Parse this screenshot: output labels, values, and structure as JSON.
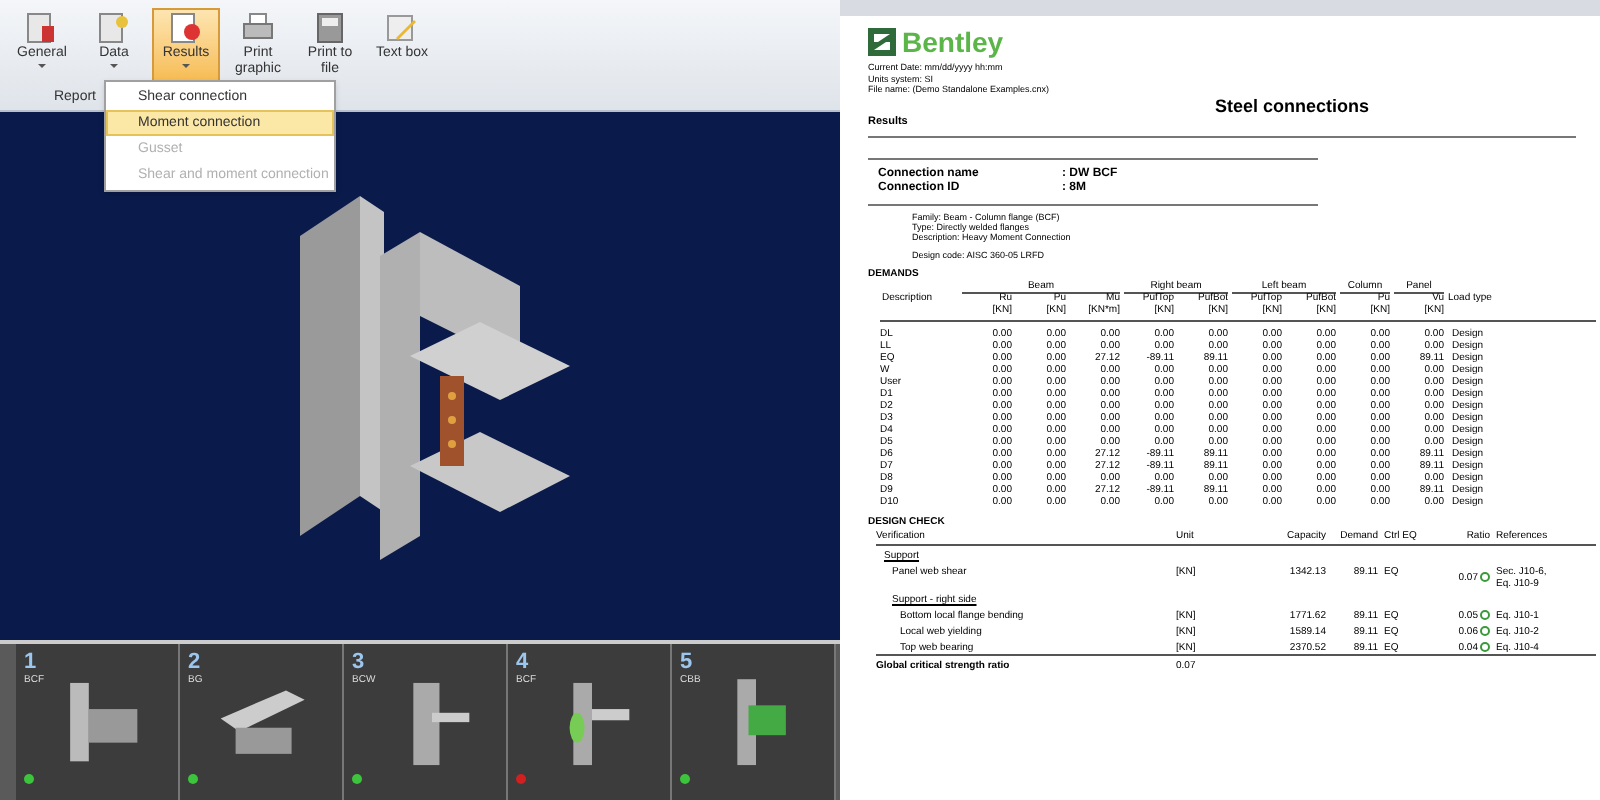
{
  "ribbon": {
    "buttons": [
      {
        "label": "General",
        "caret": true,
        "selected": false,
        "kind": "general"
      },
      {
        "label": "Data",
        "caret": true,
        "selected": false,
        "kind": "data"
      },
      {
        "label": "Results",
        "caret": true,
        "selected": true,
        "kind": "results"
      },
      {
        "label": "Print graphic",
        "caret": false,
        "selected": false,
        "kind": "printer"
      },
      {
        "label": "Print to file",
        "caret": false,
        "selected": false,
        "kind": "file"
      },
      {
        "label": "Text box",
        "caret": false,
        "selected": false,
        "kind": "text"
      }
    ],
    "group_label": "Report",
    "menu": [
      {
        "label": "Shear connection",
        "selected": false,
        "disabled": false
      },
      {
        "label": "Moment connection",
        "selected": true,
        "disabled": false
      },
      {
        "label": "Gusset",
        "selected": false,
        "disabled": true
      },
      {
        "label": "Shear and moment connection",
        "selected": false,
        "disabled": true
      }
    ]
  },
  "thumbnails": [
    {
      "number": "1",
      "code": "BCF",
      "color": "#3cc43c",
      "kind": "bcf"
    },
    {
      "number": "2",
      "code": "BG",
      "color": "#3cc43c",
      "kind": "bg"
    },
    {
      "number": "3",
      "code": "BCW",
      "color": "#3cc43c",
      "kind": "bcw"
    },
    {
      "number": "4",
      "code": "BCF",
      "color": "#d02020",
      "kind": "bcf2"
    },
    {
      "number": "5",
      "code": "CBB",
      "color": "#3cc43c",
      "kind": "cbb"
    }
  ],
  "report": {
    "logo": "Bentley",
    "meta": [
      "Current Date: mm/dd/yyyy hh:mm",
      "Units system: SI",
      "File name: (Demo Standalone Examples.cnx)"
    ],
    "title": "Steel connections",
    "section": "Results",
    "connection": [
      {
        "label": "Connection name",
        "value": ": DW BCF"
      },
      {
        "label": "Connection ID",
        "value": ": 8M"
      }
    ],
    "details": [
      "Family: Beam - Column flange (BCF)",
      "Type: Directly welded flanges",
      "Description: Heavy Moment Connection"
    ],
    "design_code": "Design code: AISC 360-05 LRFD",
    "demands": {
      "heading": "DEMANDS",
      "groups": [
        {
          "label": "Beam"
        },
        {
          "label": "Right beam"
        },
        {
          "label": "Left beam"
        },
        {
          "label": "Column"
        },
        {
          "label": "Panel"
        }
      ],
      "columns": [
        {
          "name": "Description"
        },
        {
          "name": "Ru",
          "unit": "[KN]"
        },
        {
          "name": "Pu",
          "unit": "[KN]"
        },
        {
          "name": "Mu",
          "unit": "[KN*m]"
        },
        {
          "name": "PufTop",
          "unit": "[KN]"
        },
        {
          "name": "PufBot",
          "unit": "[KN]"
        },
        {
          "name": "PufTop",
          "unit": "[KN]"
        },
        {
          "name": "PufBot",
          "unit": "[KN]"
        },
        {
          "name": "Pu",
          "unit": "[KN]"
        },
        {
          "name": "Vu",
          "unit": "[KN]"
        },
        {
          "name": "Load type"
        }
      ],
      "rows": [
        [
          "DL",
          "0.00",
          "0.00",
          "0.00",
          "0.00",
          "0.00",
          "0.00",
          "0.00",
          "0.00",
          "0.00",
          "Design"
        ],
        [
          "LL",
          "0.00",
          "0.00",
          "0.00",
          "0.00",
          "0.00",
          "0.00",
          "0.00",
          "0.00",
          "0.00",
          "Design"
        ],
        [
          "EQ",
          "0.00",
          "0.00",
          "27.12",
          "-89.11",
          "89.11",
          "0.00",
          "0.00",
          "0.00",
          "89.11",
          "Design"
        ],
        [
          "W",
          "0.00",
          "0.00",
          "0.00",
          "0.00",
          "0.00",
          "0.00",
          "0.00",
          "0.00",
          "0.00",
          "Design"
        ],
        [
          "User",
          "0.00",
          "0.00",
          "0.00",
          "0.00",
          "0.00",
          "0.00",
          "0.00",
          "0.00",
          "0.00",
          "Design"
        ],
        [
          "D1",
          "0.00",
          "0.00",
          "0.00",
          "0.00",
          "0.00",
          "0.00",
          "0.00",
          "0.00",
          "0.00",
          "Design"
        ],
        [
          "D2",
          "0.00",
          "0.00",
          "0.00",
          "0.00",
          "0.00",
          "0.00",
          "0.00",
          "0.00",
          "0.00",
          "Design"
        ],
        [
          "D3",
          "0.00",
          "0.00",
          "0.00",
          "0.00",
          "0.00",
          "0.00",
          "0.00",
          "0.00",
          "0.00",
          "Design"
        ],
        [
          "D4",
          "0.00",
          "0.00",
          "0.00",
          "0.00",
          "0.00",
          "0.00",
          "0.00",
          "0.00",
          "0.00",
          "Design"
        ],
        [
          "D5",
          "0.00",
          "0.00",
          "0.00",
          "0.00",
          "0.00",
          "0.00",
          "0.00",
          "0.00",
          "0.00",
          "Design"
        ],
        [
          "D6",
          "0.00",
          "0.00",
          "27.12",
          "-89.11",
          "89.11",
          "0.00",
          "0.00",
          "0.00",
          "89.11",
          "Design"
        ],
        [
          "D7",
          "0.00",
          "0.00",
          "27.12",
          "-89.11",
          "89.11",
          "0.00",
          "0.00",
          "0.00",
          "89.11",
          "Design"
        ],
        [
          "D8",
          "0.00",
          "0.00",
          "0.00",
          "0.00",
          "0.00",
          "0.00",
          "0.00",
          "0.00",
          "0.00",
          "Design"
        ],
        [
          "D9",
          "0.00",
          "0.00",
          "27.12",
          "-89.11",
          "89.11",
          "0.00",
          "0.00",
          "0.00",
          "89.11",
          "Design"
        ],
        [
          "D10",
          "0.00",
          "0.00",
          "0.00",
          "0.00",
          "0.00",
          "0.00",
          "0.00",
          "0.00",
          "0.00",
          "Design"
        ]
      ]
    },
    "design_check": {
      "heading": "DESIGN CHECK",
      "columns": [
        "Verification",
        "Unit",
        "Capacity",
        "Demand",
        "Ctrl EQ",
        "Ratio",
        "References"
      ],
      "rows": [
        {
          "kind": "group",
          "label": "Support"
        },
        {
          "kind": "item",
          "label": "Panel web shear",
          "unit": "[KN]",
          "capacity": "1342.13",
          "demand": "89.11",
          "ctrl": "EQ",
          "ratio": "0.07",
          "references": [
            "Sec. J10-6,",
            "Eq. J10-9"
          ]
        },
        {
          "kind": "subgroup",
          "label": "Support - right side"
        },
        {
          "kind": "subitem",
          "label": "Bottom local flange bending",
          "unit": "[KN]",
          "capacity": "1771.62",
          "demand": "89.11",
          "ctrl": "EQ",
          "ratio": "0.05",
          "references": [
            "Eq. J10-1"
          ]
        },
        {
          "kind": "subitem",
          "label": "Local web yielding",
          "unit": "[KN]",
          "capacity": "1589.14",
          "demand": "89.11",
          "ctrl": "EQ",
          "ratio": "0.06",
          "references": [
            "Eq. J10-2"
          ]
        },
        {
          "kind": "subitem",
          "label": "Top web bearing",
          "unit": "[KN]",
          "capacity": "2370.52",
          "demand": "89.11",
          "ctrl": "EQ",
          "ratio": "0.04",
          "references": [
            "Eq. J10-4"
          ]
        },
        {
          "kind": "total",
          "label": "Global critical strength ratio",
          "unit": "0.07"
        }
      ]
    }
  }
}
